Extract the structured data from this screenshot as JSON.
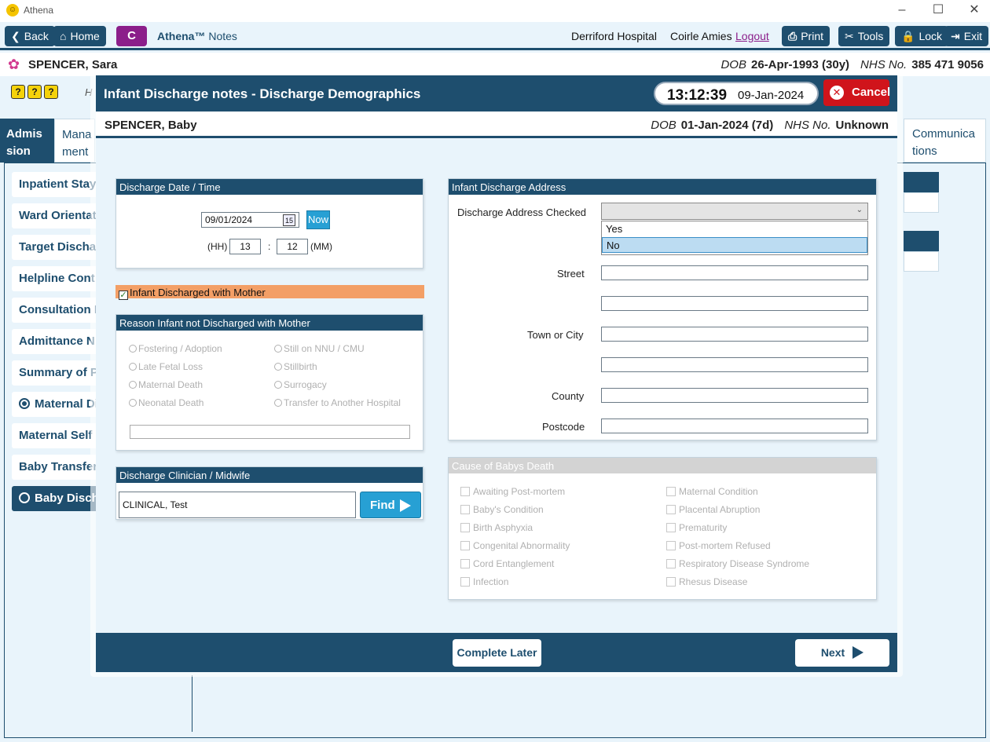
{
  "app": {
    "title": "Athena"
  },
  "toolbar": {
    "back": "Back",
    "home": "Home",
    "c_label": "C",
    "brand_bold": "Athena™",
    "brand_rest": "Notes",
    "hospital": "Derriford Hospital",
    "user": "Coirle Amies",
    "logout": "Logout",
    "print": "Print",
    "tools": "Tools",
    "lock": "Lock",
    "exit": "Exit"
  },
  "patient": {
    "name": "SPENCER, Sara",
    "dob_label": "DOB",
    "dob": "26-Apr-1993 (30y)",
    "nhs_label": "NHS No.",
    "nhs": "385 471 9056"
  },
  "background": {
    "header_initial": "H",
    "tabs": {
      "active": "Admis sion",
      "other": "Mana ment",
      "comm": "Communica tions"
    },
    "nav": [
      "Inpatient Stay",
      "Ward Orientat",
      "Target Dischar",
      "Helpline Cont",
      "Consultation I",
      "Admittance N",
      "Summary of P",
      "Maternal Di",
      "Maternal Self",
      "Baby Transfer",
      "Baby Discha"
    ]
  },
  "modal": {
    "title": "Infant Discharge notes - Discharge Demographics",
    "time": "13:12:39",
    "date": "09-Jan-2024",
    "cancel": "Cancel",
    "baby_name": "SPENCER, Baby",
    "baby_dob_label": "DOB",
    "baby_dob": "01-Jan-2024 (7d)",
    "baby_nhs_label": "NHS No.",
    "baby_nhs": "Unknown",
    "complete_later": "Complete Later",
    "next": "Next"
  },
  "discharge_dt": {
    "header": "Discharge Date / Time",
    "date": "09/01/2024",
    "cal_day": "15",
    "now": "Now",
    "hh_label": "(HH)",
    "hh": "13",
    "sep": ":",
    "mm": "12",
    "mm_label": "(MM)"
  },
  "with_mother": {
    "label": "Infant Discharged with Mother",
    "checked": true
  },
  "reason": {
    "header": "Reason Infant not Discharged with Mother",
    "col1": [
      "Fostering / Adoption",
      "Late Fetal Loss",
      "Maternal Death",
      "Neonatal Death"
    ],
    "col2": [
      "Still on NNU / CMU",
      "Stillbirth",
      "Surrogacy",
      "Transfer to Another Hospital"
    ],
    "other_value": ""
  },
  "clinician": {
    "header": "Discharge Clinician / Midwife",
    "value": "CLINICAL, Test",
    "find": "Find"
  },
  "address": {
    "header": "Infant Discharge Address",
    "checked_label": "Discharge Address Checked",
    "checked_value": "",
    "options": [
      "Yes",
      "No"
    ],
    "highlighted": "No",
    "street_label": "Street",
    "street1": "",
    "street2": "",
    "town_label": "Town or City",
    "town1": "",
    "town2": "",
    "county_label": "County",
    "county": "",
    "postcode_label": "Postcode",
    "postcode": ""
  },
  "cause": {
    "header": "Cause of Babys Death",
    "col1": [
      "Awaiting Post-mortem",
      "Baby's Condition",
      "Birth Asphyxia",
      "Congenital Abnormality",
      "Cord Entanglement",
      "Infection"
    ],
    "col2": [
      "Maternal Condition",
      "Placental Abruption",
      "Prematurity",
      "Post-mortem Refused",
      "Respiratory Disease Syndrome",
      "Rhesus Disease"
    ]
  },
  "colors": {
    "primary": "#1e4e6e",
    "accent": "#27a0d4",
    "cancel": "#d0141b",
    "highlight": "#f39f66",
    "c_button": "#8b1e8a"
  }
}
